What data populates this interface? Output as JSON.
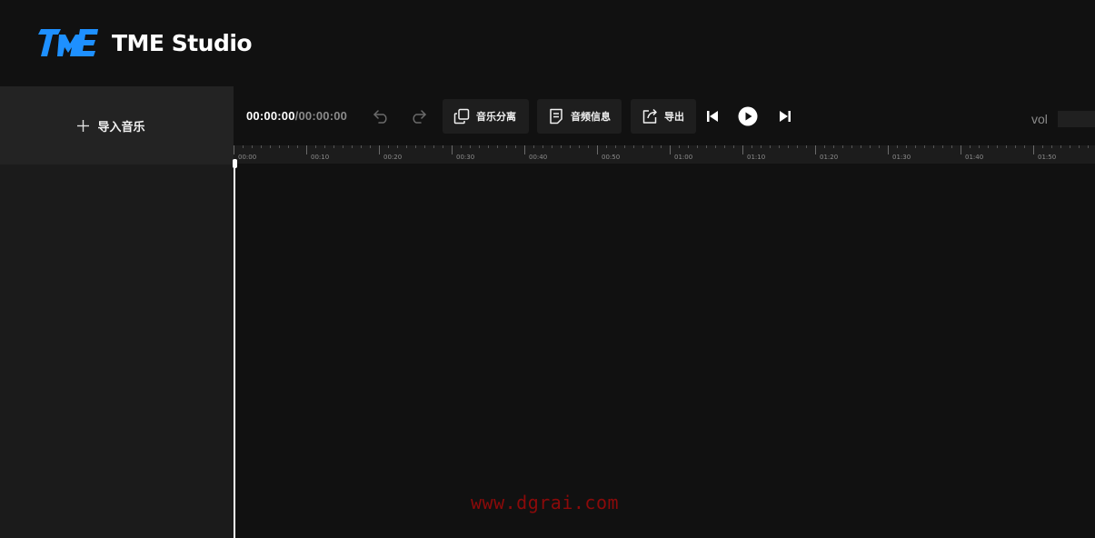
{
  "app": {
    "name": "TME Studio"
  },
  "sidebar": {
    "import_label": "导入音乐"
  },
  "toolbar": {
    "time_current": "00:00:00",
    "time_separator": "/",
    "time_total": "00:00:00",
    "separate_label": "音乐分离",
    "info_label": "音频信息",
    "export_label": "导出",
    "vol_label": "vol"
  },
  "timeline": {
    "ticks": [
      "00:00",
      "00:10",
      "00:20",
      "00:30",
      "00:40",
      "00:50",
      "01:00",
      "01:10",
      "01:20",
      "01:30",
      "01:40",
      "01:50"
    ],
    "playhead_seconds": 0
  },
  "icons": {
    "logo": "tme-logo-icon",
    "import": "plus-icon",
    "undo": "undo-icon",
    "redo": "redo-icon",
    "separate": "copy-icon",
    "info": "document-icon",
    "export": "share-icon",
    "previous": "skip-previous-icon",
    "play": "play-icon",
    "next": "skip-next-icon"
  },
  "colors": {
    "brand": "#1e90ff",
    "background": "#111111",
    "panel": "#1b1b1b"
  },
  "watermark": "www.dgrai.com"
}
